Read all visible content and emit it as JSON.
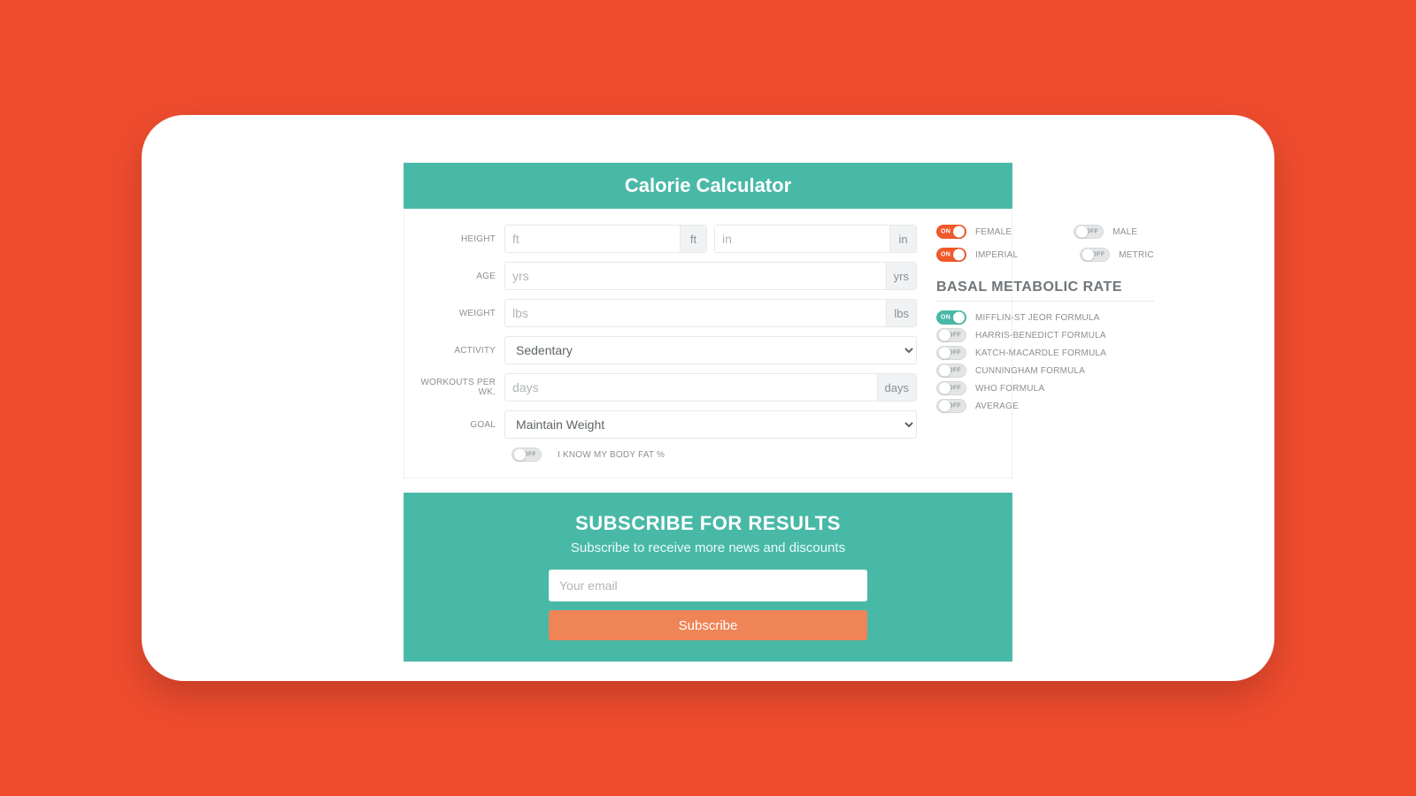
{
  "header": {
    "title": "Calorie Calculator"
  },
  "form": {
    "height": {
      "label": "HEIGHT",
      "ft_ph": "ft",
      "ft_unit": "ft",
      "in_ph": "in",
      "in_unit": "in"
    },
    "age": {
      "label": "AGE",
      "ph": "yrs",
      "unit": "yrs"
    },
    "weight": {
      "label": "WEIGHT",
      "ph": "lbs",
      "unit": "lbs"
    },
    "activity": {
      "label": "ACTIVITY",
      "selected": "Sedentary"
    },
    "workouts": {
      "label": "WORKOUTS PER WK.",
      "ph": "days",
      "unit": "days"
    },
    "goal": {
      "label": "GOAL",
      "selected": "Maintain Weight"
    },
    "bodyfat": {
      "label": "I KNOW MY BODY FAT %",
      "state": "OFF"
    }
  },
  "toggles": {
    "gender": {
      "female": {
        "label": "FEMALE",
        "state": "ON"
      },
      "male": {
        "label": "MALE",
        "state": "OFF"
      }
    },
    "units": {
      "imperial": {
        "label": "IMPERIAL",
        "state": "ON"
      },
      "metric": {
        "label": "METRIC",
        "state": "OFF"
      }
    }
  },
  "bmr": {
    "title": "BASAL METABOLIC RATE",
    "formulas": [
      {
        "label": "MIFFLIN-ST JEOR FORMULA",
        "state": "ON"
      },
      {
        "label": "HARRIS-BENEDICT FORMULA",
        "state": "OFF"
      },
      {
        "label": "KATCH-MACARDLE FORMULA",
        "state": "OFF"
      },
      {
        "label": "CUNNINGHAM FORMULA",
        "state": "OFF"
      },
      {
        "label": "WHO FORMULA",
        "state": "OFF"
      },
      {
        "label": "AVERAGE",
        "state": "OFF"
      }
    ]
  },
  "subscribe": {
    "title": "SUBSCRIBE FOR RESULTS",
    "desc": "Subscribe to receive more news and discounts",
    "placeholder": "Your email",
    "button": "Subscribe"
  }
}
